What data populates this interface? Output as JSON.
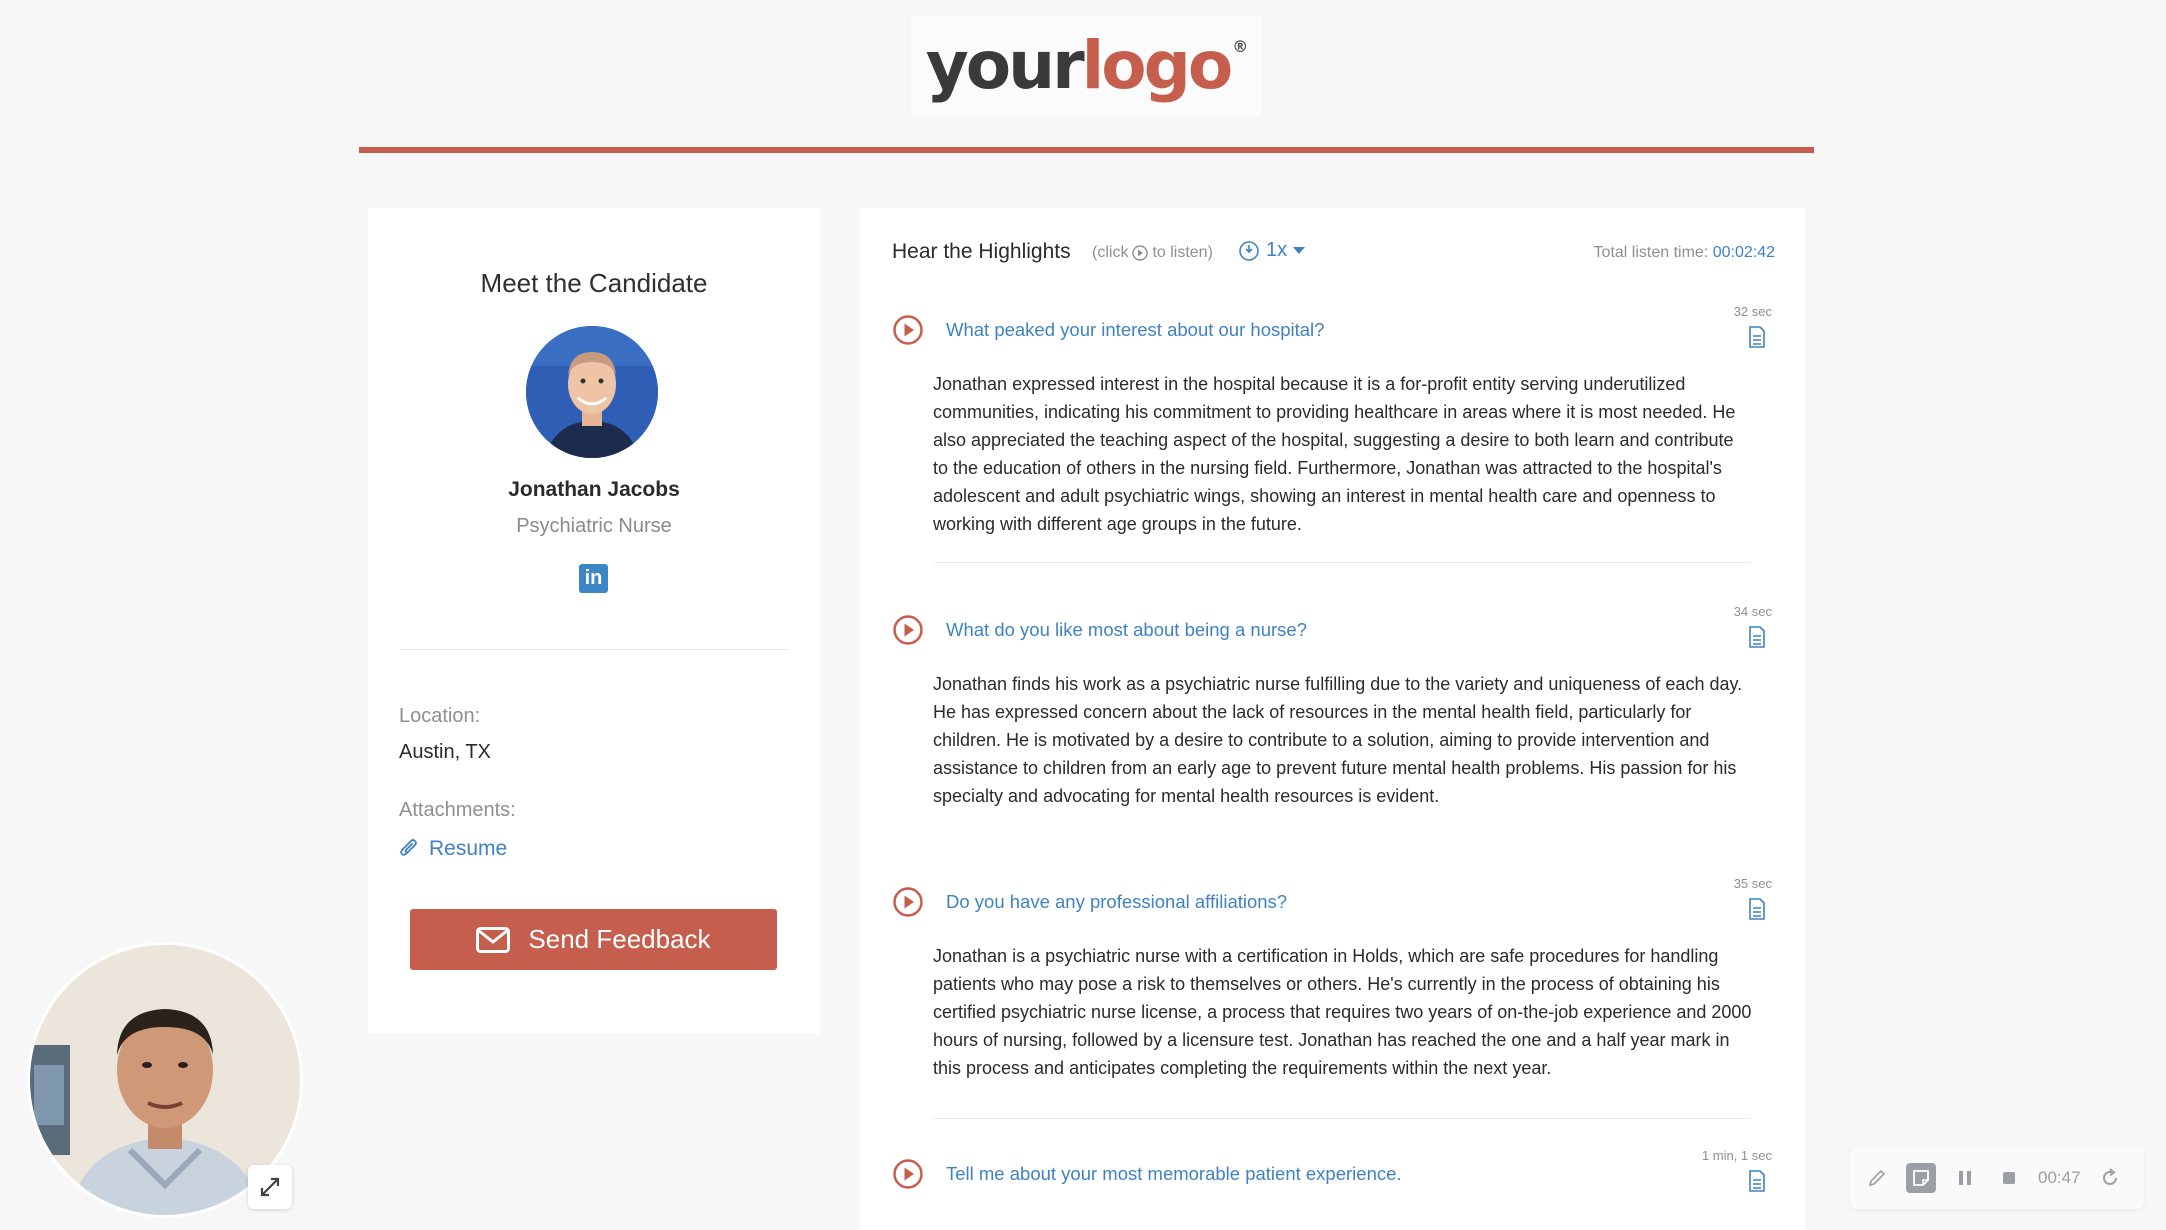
{
  "brand": {
    "logo_word1": "your",
    "logo_word2": "logo",
    "logo_mark": "®",
    "accent": "#c65e4e",
    "link": "#3f82c1"
  },
  "candidate_card": {
    "title": "Meet the Candidate",
    "name": "Jonathan Jacobs",
    "role": "Psychiatric Nurse",
    "linkedin_icon": "linkedin-icon",
    "location_label": "Location:",
    "location_value": "Austin, TX",
    "attachments_label": "Attachments:",
    "resume_label": "Resume",
    "feedback_label": "Send Feedback"
  },
  "highlights": {
    "title": "Hear the Highlights",
    "hint_pre": "(click",
    "hint_post": "to listen)",
    "speed": "1x",
    "total_label": "Total listen time:",
    "total_value": "00:02:42",
    "items": [
      {
        "question": "What peaked your interest about our hospital?",
        "duration": "32 sec",
        "answer": "Jonathan expressed interest in the hospital because it is a for-profit entity serving underutilized communities, indicating his commitment to providing healthcare in areas where it is most needed. He also appreciated the teaching aspect of the hospital, suggesting a desire to both learn and contribute to the education of others in the nursing field. Furthermore, Jonathan was attracted to the hospital's adolescent and adult psychiatric wings, showing an interest in mental health care and openness to working with different age groups in the future."
      },
      {
        "question": "What do you like most about being a nurse?",
        "duration": "34 sec",
        "answer": "Jonathan finds his work as a psychiatric nurse fulfilling due to the variety and uniqueness of each day. He has expressed concern about the lack of resources in the mental health field, particularly for children. He is motivated by a desire to contribute to a solution, aiming to provide intervention and assistance to children from an early age to prevent future mental health problems. His passion for his specialty and advocating for mental health resources is evident."
      },
      {
        "question": "Do you have any professional affiliations?",
        "duration": "35 sec",
        "answer": "Jonathan is a psychiatric nurse with a certification in Holds, which are safe procedures for handling patients who may pose a risk to themselves or others. He's currently in the process of obtaining his certified psychiatric nurse license, a process that requires two years of on-the-job experience and 2000 hours of nursing, followed by a licensure test. Jonathan has reached the one and a half year mark in this process and anticipates completing the requirements within the next year."
      },
      {
        "question": "Tell me about your most memorable patient experience.",
        "duration": "1 min, 1 sec",
        "answer": ""
      }
    ]
  },
  "recorder": {
    "time": "00:47"
  }
}
